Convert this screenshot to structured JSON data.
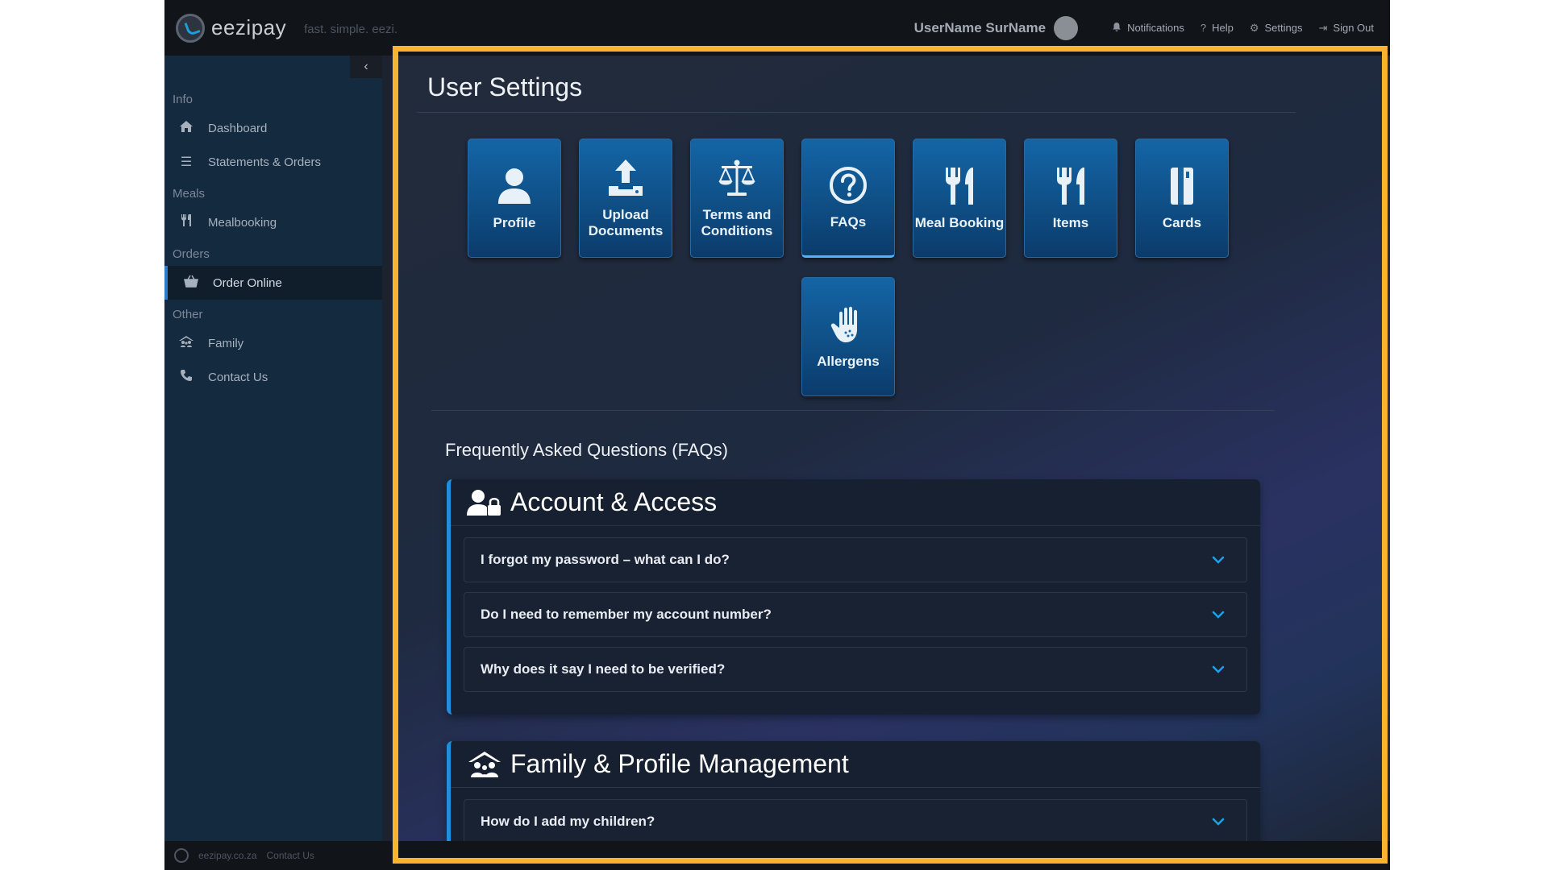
{
  "topbar": {
    "brand": "eezipay",
    "tagline": "fast. simple. eezi.",
    "username": "UserName SurName",
    "links": [
      {
        "label": "Notifications",
        "icon": "bell-icon"
      },
      {
        "label": "Help",
        "icon": "question-icon"
      },
      {
        "label": "Settings",
        "icon": "gear-icon"
      },
      {
        "label": "Sign Out",
        "icon": "sign-out-icon"
      }
    ]
  },
  "sidebar": {
    "sections": [
      {
        "title": "Info",
        "items": [
          {
            "label": "Dashboard",
            "icon": "home-icon"
          },
          {
            "label": "Statements & Orders",
            "icon": "list-icon"
          }
        ]
      },
      {
        "title": "Meals",
        "items": [
          {
            "label": "Mealbooking",
            "icon": "cutlery-icon"
          }
        ]
      },
      {
        "title": "Orders",
        "items": [
          {
            "label": "Order Online",
            "icon": "basket-icon",
            "active": true
          }
        ]
      },
      {
        "title": "Other",
        "items": [
          {
            "label": "Family",
            "icon": "family-icon"
          },
          {
            "label": "Contact Us",
            "icon": "phone-icon"
          }
        ]
      }
    ]
  },
  "main": {
    "title": "User Settings",
    "tiles": [
      {
        "label": "Profile",
        "icon": "user-icon"
      },
      {
        "label": "Upload Documents",
        "icon": "upload-icon"
      },
      {
        "label": "Terms and Conditions",
        "icon": "scales-icon"
      },
      {
        "label": "FAQs",
        "icon": "question-circle-icon",
        "active": true
      },
      {
        "label": "Meal Booking",
        "icon": "cutlery-icon"
      },
      {
        "label": "Items",
        "icon": "cutlery-icon"
      },
      {
        "label": "Cards",
        "icon": "card-icon"
      },
      {
        "label": "Allergens",
        "icon": "hand-icon"
      }
    ],
    "faq_heading": "Frequently Asked Questions (FAQs)",
    "faq_groups": [
      {
        "title": "Account & Access",
        "icon": "user-lock-icon",
        "questions": [
          "I forgot my password – what can I do?",
          "Do I need to remember my account number?",
          "Why does it say I need to be verified?"
        ]
      },
      {
        "title": "Family & Profile Management",
        "icon": "family-icon",
        "questions": [
          "How do I add my children?"
        ]
      }
    ]
  },
  "footer": {
    "site": "eezipay.co.za",
    "contact": "Contact Us"
  },
  "colors": {
    "accent": "#1f8fe0",
    "highlight_frame": "#f7b42c",
    "tile": "#1465a6"
  }
}
